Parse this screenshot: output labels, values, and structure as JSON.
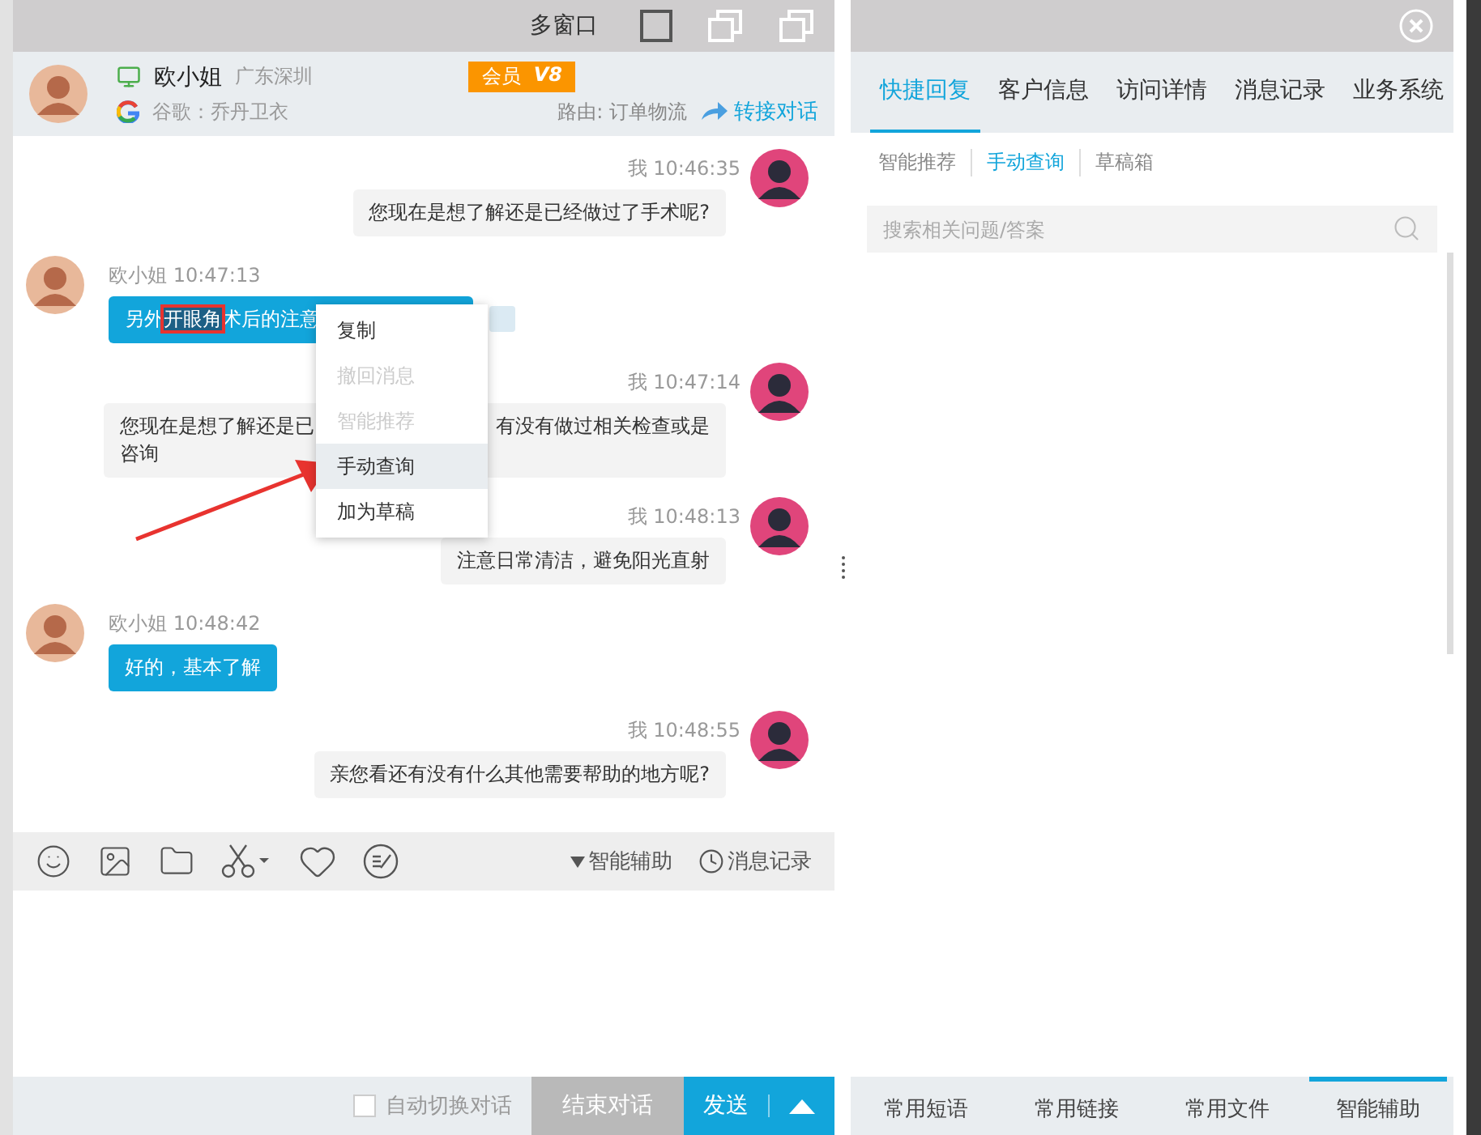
{
  "chat_window": {
    "title": "多窗口"
  },
  "visitor": {
    "name": "欧小姐",
    "location": "广东深圳",
    "source": "谷歌：乔丹卫衣",
    "badge": "会员",
    "level_badge": "V8",
    "route": "路由: 订单物流",
    "transfer": "转接对话"
  },
  "messages": [
    {
      "kind": "sent",
      "sender": "我",
      "time": "10:46:35",
      "hidden_tail": false,
      "side_icon": false,
      "lines": [
        {
          "parts": [
            {
              "text": "您现在是想了解还是已经做过了手术呢?",
              "selected": false
            }
          ]
        }
      ]
    },
    {
      "kind": "received",
      "sender": "欧小姐",
      "time": "10:47:13",
      "hidden_tail": true,
      "side_icon": true,
      "lines": [
        {
          "parts": [
            {
              "text": "另外",
              "selected": false
            },
            {
              "text": "开眼角",
              "selected": true
            },
            {
              "text": "术后的注意",
              "selected": false
            }
          ]
        }
      ]
    },
    {
      "kind": "sent",
      "sender": "我",
      "time": "10:47:14",
      "hidden_tail": false,
      "side_icon": false,
      "lines": [
        {
          "parts": [
            {
              "text": "您现在是想了解还是已",
              "selected": false
            }
          ],
          "trailing": "有没有做过相关检查或是"
        },
        {
          "parts": [
            {
              "text": "咨询",
              "selected": false
            }
          ]
        }
      ]
    },
    {
      "kind": "sent",
      "sender": "我",
      "time": "10:48:13",
      "hidden_tail": false,
      "side_icon": false,
      "lines": [
        {
          "parts": [
            {
              "text": "注意日常清洁，避免阳光直射",
              "selected": false
            }
          ]
        }
      ]
    },
    {
      "kind": "received",
      "sender": "欧小姐",
      "time": "10:48:42",
      "hidden_tail": false,
      "side_icon": false,
      "lines": [
        {
          "parts": [
            {
              "text": "好的，基本了解",
              "selected": false
            }
          ]
        }
      ]
    },
    {
      "kind": "sent",
      "sender": "我",
      "time": "10:48:55",
      "hidden_tail": false,
      "side_icon": false,
      "lines": [
        {
          "parts": [
            {
              "text": "亲您看还有没有什么其他需要帮助的地方呢?",
              "selected": false
            }
          ]
        }
      ]
    }
  ],
  "context_menu": [
    {
      "label": "复制",
      "disabled": false,
      "selected": false
    },
    {
      "label": "撤回消息",
      "disabled": true,
      "selected": false
    },
    {
      "label": "智能推荐",
      "disabled": true,
      "selected": false
    },
    {
      "label": "手动查询",
      "disabled": false,
      "selected": true
    },
    {
      "label": "加为草稿",
      "disabled": false,
      "selected": false
    }
  ],
  "toolbar": {
    "assist": "智能辅助",
    "history": "消息记录"
  },
  "footer": {
    "auto_switch": {
      "label": "自动切换对话",
      "checked": false
    },
    "end_button": "结束对话",
    "send_button": "发送"
  },
  "side_panel": {
    "tabs": [
      {
        "label": "快捷回复",
        "selected": true
      },
      {
        "label": "客户信息",
        "selected": false
      },
      {
        "label": "访问详情",
        "selected": false
      },
      {
        "label": "消息记录",
        "selected": false
      },
      {
        "label": "业务系统",
        "selected": false
      }
    ],
    "sub_tabs": [
      {
        "label": "智能推荐",
        "selected": false
      },
      {
        "label": "手动查询",
        "selected": true
      },
      {
        "label": "草稿箱",
        "selected": false
      }
    ],
    "search": {
      "placeholder": "搜索相关问题/答案"
    },
    "bottom_tabs": [
      {
        "label": "常用短语",
        "selected": false
      },
      {
        "label": "常用链接",
        "selected": false
      },
      {
        "label": "常用文件",
        "selected": false
      },
      {
        "label": "智能辅助",
        "selected": true
      }
    ]
  }
}
